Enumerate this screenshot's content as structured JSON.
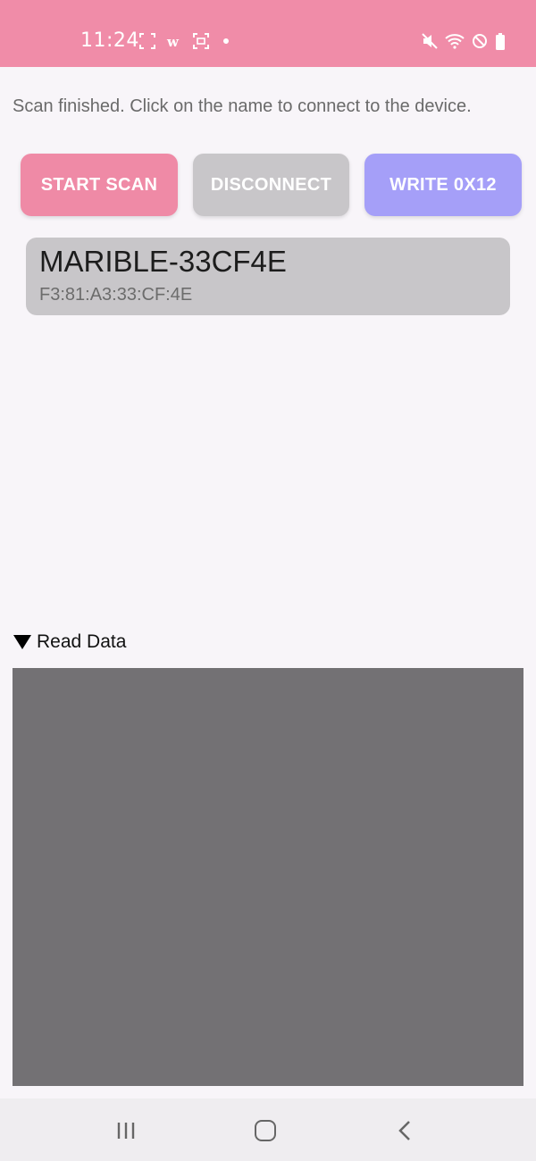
{
  "status_bar": {
    "time": "11:24",
    "left_icons": [
      "screenshot-frame-icon",
      "w-app-icon",
      "screen-record-icon",
      "notification-dot-icon"
    ],
    "right_icons": [
      "mute-icon",
      "wifi-icon",
      "do-not-disturb-icon",
      "battery-icon"
    ]
  },
  "message": "Scan finished. Click on the name to connect to the device.",
  "buttons": {
    "start_scan": "START SCAN",
    "disconnect": "DISCONNECT",
    "write": "WRITE 0X12"
  },
  "devices": [
    {
      "name": "MARIBLE-33CF4E",
      "address": "F3:81:A3:33:CF:4E"
    }
  ],
  "read_data": {
    "label": "Read Data"
  },
  "nav_bar": {
    "icons": [
      "recent-apps-icon",
      "home-icon",
      "back-icon"
    ]
  },
  "colors": {
    "accent_pink": "#f08ca8",
    "disabled_gray": "#c8c6c9",
    "write_purple": "#a59ff8",
    "read_area": "#737174"
  }
}
